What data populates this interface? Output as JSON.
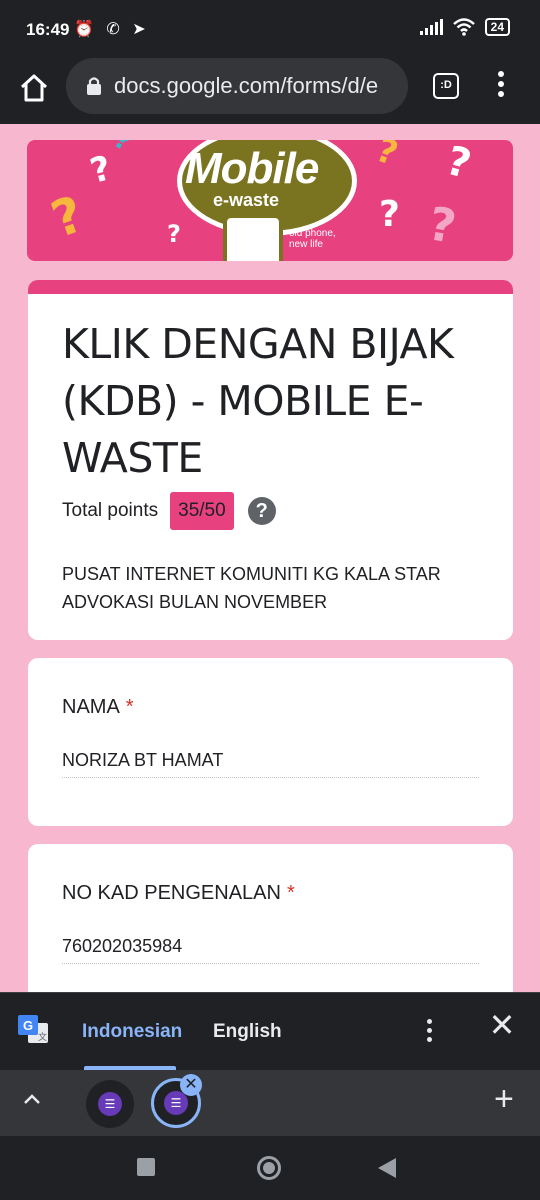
{
  "status_bar": {
    "time": "16:49",
    "notification_icons": "⏰ ✆ ➤",
    "battery": "24"
  },
  "browser": {
    "url": "docs.google.com/forms/d/e",
    "tab_switcher_label": ":D",
    "icons": [
      "home-icon",
      "lock-icon",
      "tab-switcher-icon",
      "more-vert-icon"
    ]
  },
  "banner": {
    "logo_line1": "Mobile",
    "logo_line2": "e-waste",
    "tagline": "old phone, new life"
  },
  "form": {
    "title": "KLIK DENGAN BIJAK (KDB) - MOBILE E-WASTE",
    "points_label": "Total points",
    "points_value": "35/50",
    "description_line1": "PUSAT INTERNET KOMUNITI KG KALA STAR",
    "description_line2": "ADVOKASI BULAN NOVEMBER",
    "questions": [
      {
        "label": "NAMA",
        "required_mark": "*",
        "answer": "NORIZA BT HAMAT"
      },
      {
        "label": "NO KAD PENGENALAN",
        "required_mark": "*",
        "answer": "760202035984"
      }
    ]
  },
  "translate_bar": {
    "source_language": "Indonesian",
    "target_language": "English"
  },
  "tab_strip": {
    "new_tab": "+"
  },
  "colors": {
    "accent": "#e8417f",
    "page_bg": "#f7b8cf",
    "chrome_dark": "#202124",
    "link_blue": "#8ab4f8"
  }
}
